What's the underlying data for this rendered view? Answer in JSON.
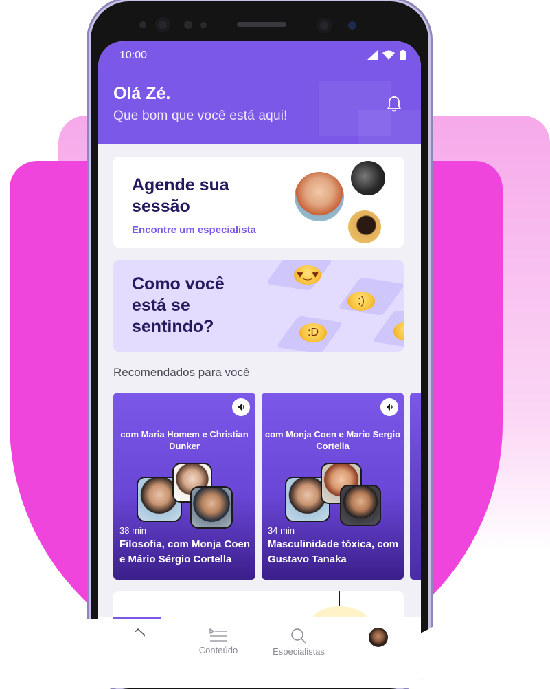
{
  "status_bar": {
    "time": "10:00"
  },
  "header": {
    "greeting": "Olá Zé.",
    "subtitle": "Que bom que você está aqui!"
  },
  "schedule_card": {
    "title": "Agende sua sessão",
    "link": "Encontre um especialista"
  },
  "mood_card": {
    "title": "Como você está se sentindo?"
  },
  "recommended": {
    "section_title": "Recomendados para você",
    "items": [
      {
        "with": "com Maria Homem e Christian Dunker",
        "duration": "38 min",
        "title": "Filosofia, com Monja Coen e Mário Sérgio Cortella"
      },
      {
        "with": "com Monja Coen e Mario Sergio Cortella",
        "duration": "34 min",
        "title": "Masculinidade tóxica, com Gustavo Tanaka"
      }
    ]
  },
  "tabbar": {
    "tabs": [
      {
        "label": ""
      },
      {
        "label": "Conteúdo"
      },
      {
        "label": "Especialistas"
      },
      {
        "label": ""
      }
    ]
  },
  "colors": {
    "accent": "#7b58e8",
    "brand_pink": "#ef45dd",
    "title_navy": "#261a5e"
  }
}
